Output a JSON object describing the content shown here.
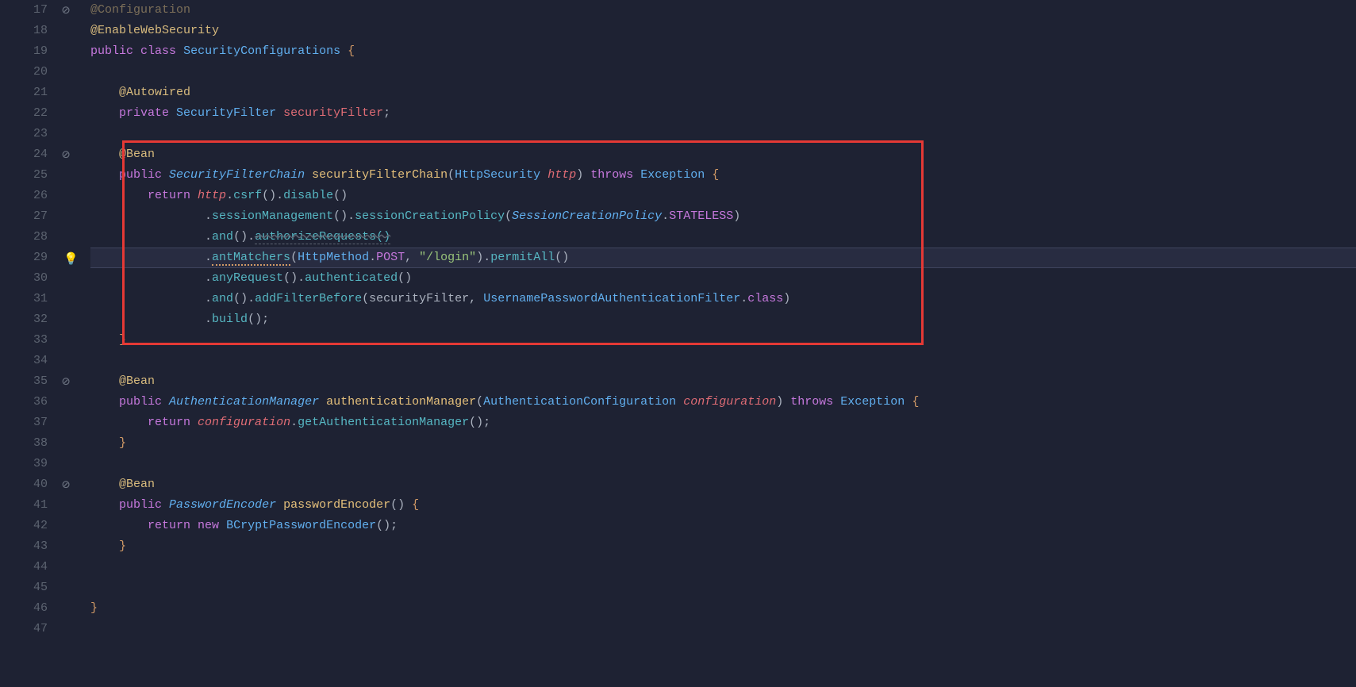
{
  "lineNumbers": [
    "17",
    "18",
    "19",
    "20",
    "21",
    "22",
    "23",
    "24",
    "25",
    "26",
    "27",
    "28",
    "29",
    "30",
    "31",
    "32",
    "33",
    "34",
    "35",
    "36",
    "37",
    "38",
    "39",
    "40",
    "41",
    "42",
    "43",
    "44",
    "45",
    "46",
    "47"
  ],
  "markers": {
    "17": "nosymbol",
    "24": "nosymbol",
    "29": "bulb",
    "35": "nosymbol",
    "40": "nosymbol"
  },
  "code": {
    "l17": {
      "t0": "@Configuration"
    },
    "l18": {
      "t0": "@EnableWebSecurity"
    },
    "l19": {
      "t0": "public",
      "t1": "class",
      "t2": "SecurityConfigurations",
      "t3": "{"
    },
    "l21": {
      "t0": "@Autowired"
    },
    "l22": {
      "t0": "private",
      "t1": "SecurityFilter",
      "t2": "securityFilter",
      "t3": ";"
    },
    "l24": {
      "t0": "@Bean"
    },
    "l25": {
      "t0": "public",
      "t1": "SecurityFilterChain",
      "t2": "securityFilterChain",
      "t3": "(",
      "t4": "HttpSecurity",
      "t5": "http",
      "t6": ")",
      "t7": "throws",
      "t8": "Exception",
      "t9": "{"
    },
    "l26": {
      "t0": "return",
      "t1": "http",
      "t2": ".",
      "t3": "csrf",
      "t4": "().",
      "t5": "disable",
      "t6": "()"
    },
    "l27": {
      "t0": ".",
      "t1": "sessionManagement",
      "t2": "().",
      "t3": "sessionCreationPolicy",
      "t4": "(",
      "t5": "SessionCreationPolicy",
      "t6": ".",
      "t7": "STATELESS",
      "t8": ")"
    },
    "l28": {
      "t0": ".",
      "t1": "and",
      "t2": "().",
      "t3": "authorizeRequests()",
      "t4": ""
    },
    "l29": {
      "t0": ".",
      "t1": "antMatchers",
      "t2": "(",
      "t3": "HttpMethod",
      "t4": ".",
      "t5": "POST",
      "t6": ",",
      "t7": "\"/login\"",
      "t8": ").",
      "t9": "permitAll",
      "t10": "()"
    },
    "l30": {
      "t0": ".",
      "t1": "anyRequest",
      "t2": "().",
      "t3": "authenticated",
      "t4": "()"
    },
    "l31": {
      "t0": ".",
      "t1": "and",
      "t2": "().",
      "t3": "addFilterBefore",
      "t4": "(",
      "t5": "securityFilter",
      "t6": ",",
      "t7": "UsernamePasswordAuthenticationFilter",
      "t8": ".",
      "t9": "class",
      "t10": ")"
    },
    "l32": {
      "t0": ".",
      "t1": "build",
      "t2": "();"
    },
    "l33": {
      "t0": "}"
    },
    "l35": {
      "t0": "@Bean"
    },
    "l36": {
      "t0": "public",
      "t1": "AuthenticationManager",
      "t2": "authenticationManager",
      "t3": "(",
      "t4": "AuthenticationConfiguration",
      "t5": "configuration",
      "t6": ")",
      "t7": "throws",
      "t8": "Exception",
      "t9": "{"
    },
    "l37": {
      "t0": "return",
      "t1": "configuration",
      "t2": ".",
      "t3": "getAuthenticationManager",
      "t4": "();"
    },
    "l38": {
      "t0": "}"
    },
    "l40": {
      "t0": "@Bean"
    },
    "l41": {
      "t0": "public",
      "t1": "PasswordEncoder",
      "t2": "passwordEncoder",
      "t3": "()",
      "t4": "{"
    },
    "l42": {
      "t0": "return",
      "t1": "new",
      "t2": "BCryptPasswordEncoder",
      "t3": "();"
    },
    "l43": {
      "t0": "}"
    },
    "l46": {
      "t0": "}"
    }
  }
}
